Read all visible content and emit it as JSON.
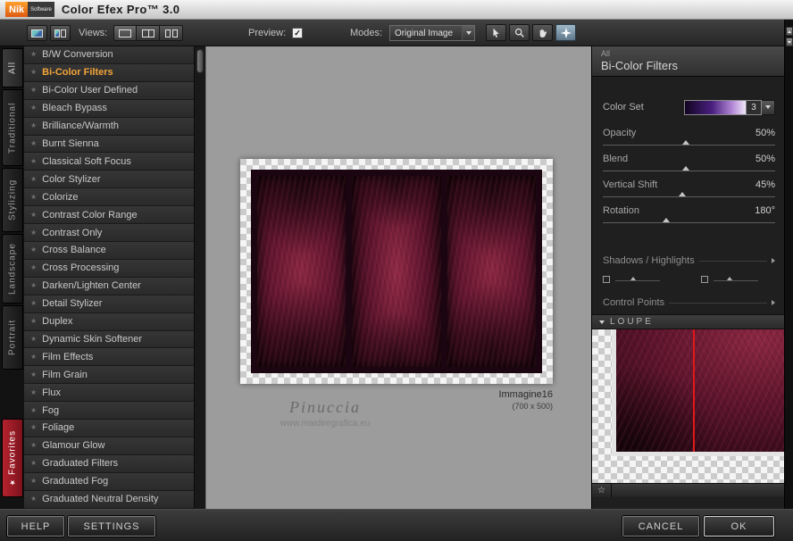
{
  "titlebar": {
    "logo_top": "Nik",
    "logo_bottom": "Software",
    "title": "Color Efex Pro™ 3.0"
  },
  "toolbar": {
    "views_label": "Views:",
    "preview_label": "Preview:",
    "preview_checked": true,
    "modes_label": "Modes:",
    "modes_value": "Original Image"
  },
  "side_tabs": [
    "All",
    "Traditional",
    "Stylizing",
    "Landscape",
    "Portrait",
    "Favorites"
  ],
  "filter_list": {
    "items": [
      "B/W Conversion",
      "Bi-Color Filters",
      "Bi-Color User Defined",
      "Bleach Bypass",
      "Brilliance/Warmth",
      "Burnt Sienna",
      "Classical Soft Focus",
      "Color Stylizer",
      "Colorize",
      "Contrast Color Range",
      "Contrast Only",
      "Cross Balance",
      "Cross Processing",
      "Darken/Lighten Center",
      "Detail Stylizer",
      "Duplex",
      "Dynamic Skin Softener",
      "Film Effects",
      "Film Grain",
      "Flux",
      "Fog",
      "Foliage",
      "Glamour Glow",
      "Graduated Filters",
      "Graduated Fog",
      "Graduated Neutral Density"
    ],
    "selected": "Bi-Color Filters"
  },
  "preview": {
    "image_label": "Immagine16",
    "image_dims": "(700 x 500)",
    "watermark_name": "Pinuccia",
    "watermark_url": "www.maidiregrafica.eu"
  },
  "params": {
    "category": "All",
    "filter_title": "Bi-Color Filters",
    "color_set_label": "Color Set",
    "color_set_value": "3",
    "sliders": [
      {
        "label": "Opacity",
        "value": "50%",
        "pct": 48
      },
      {
        "label": "Blend",
        "value": "50%",
        "pct": 48
      },
      {
        "label": "Vertical Shift",
        "value": "45%",
        "pct": 46
      },
      {
        "label": "Rotation",
        "value": "180°",
        "pct": 37
      }
    ],
    "shadows_highlights_label": "Shadows / Highlights",
    "control_points_label": "Control Points",
    "loupe_label": "LOUPE"
  },
  "footer": {
    "help_label": "HELP",
    "settings_label": "SETTINGS",
    "cancel_label": "CANCEL",
    "ok_label": "OK"
  },
  "icons": {
    "star": "★",
    "star_outline": "☆",
    "check": "✓"
  },
  "colors": {
    "accent_orange": "#f2a53a",
    "favorites_red": "#b5232e",
    "image_maroon": "#5c142c"
  }
}
